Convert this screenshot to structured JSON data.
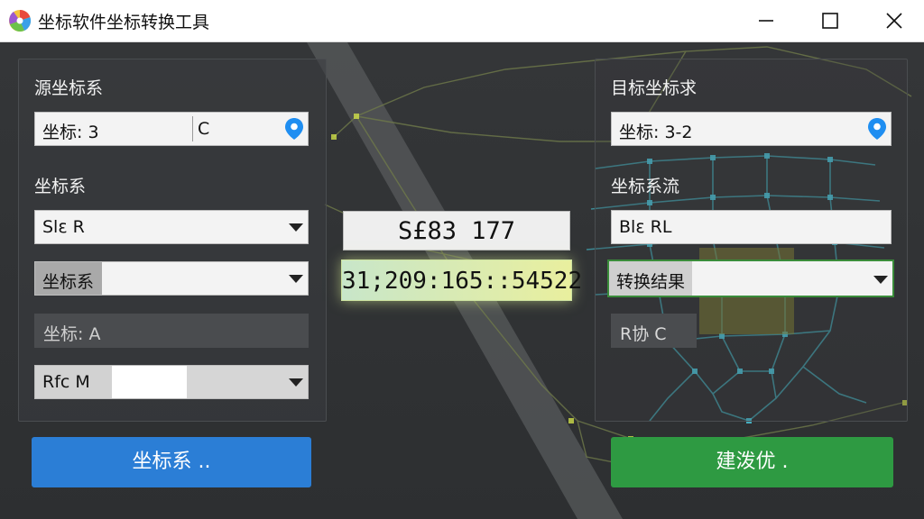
{
  "window": {
    "title": "坐标软件坐标转换工具"
  },
  "left_panel": {
    "source_label": "源坐标系",
    "source_coord_value": "坐标: 3",
    "source_coord_suffix": "C",
    "crs_label": "坐标系",
    "crs_select_value": "Slε R",
    "crs_type_label": "坐标系",
    "crs_type_value": "",
    "coord_a_label": "坐标: A",
    "rfc_label": "Rfc M",
    "rfc_value": ""
  },
  "center": {
    "readout_top": "S£83 177",
    "readout_bottom": "31;209:165::54522"
  },
  "right_panel": {
    "target_label": "目标坐标求",
    "target_coord_value": "坐标: 3-2",
    "flow_label": "坐标系流",
    "flow_value": "Blε RL",
    "result_select_value": "转换结果",
    "rdiff_label": "R协 C"
  },
  "buttons": {
    "left_label": "坐标系 ..",
    "right_label": "建泼优 ."
  },
  "colors": {
    "blue_button": "#2b7ed6",
    "green_button": "#2e9a42",
    "pin_blue": "#1f8ef1",
    "readout_bottom_from": "#c8e6c9",
    "readout_bottom_to": "#e9ef9e"
  }
}
